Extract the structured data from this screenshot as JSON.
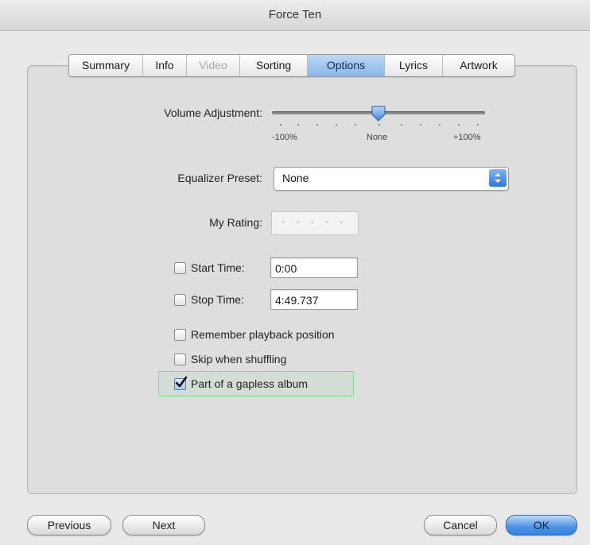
{
  "window": {
    "title": "Force Ten"
  },
  "tabs": [
    {
      "label": "Summary",
      "state": "normal"
    },
    {
      "label": "Info",
      "state": "normal"
    },
    {
      "label": "Video",
      "state": "disabled"
    },
    {
      "label": "Sorting",
      "state": "normal"
    },
    {
      "label": "Options",
      "state": "selected"
    },
    {
      "label": "Lyrics",
      "state": "normal"
    },
    {
      "label": "Artwork",
      "state": "normal"
    }
  ],
  "options": {
    "volume": {
      "label": "Volume Adjustment:",
      "min_label": "-100%",
      "mid_label": "None",
      "max_label": "+100%",
      "value_percent": 0
    },
    "equalizer": {
      "label": "Equalizer Preset:",
      "value": "None"
    },
    "rating": {
      "label": "My Rating:",
      "stars": 0,
      "placeholder": "• • • • •"
    },
    "start_time": {
      "label": "Start Time:",
      "value": "0:00",
      "checked": false
    },
    "stop_time": {
      "label": "Stop Time:",
      "value": "4:49.737",
      "checked": false
    },
    "remember_playback": {
      "label": "Remember playback position",
      "checked": false
    },
    "skip_shuffling": {
      "label": "Skip when shuffling",
      "checked": false
    },
    "gapless": {
      "label": "Part of a gapless album",
      "checked": true
    }
  },
  "buttons": {
    "previous": "Previous",
    "next": "Next",
    "cancel": "Cancel",
    "ok": "OK"
  },
  "colors": {
    "selected_tab": "#8bb6ea",
    "highlight_border": "#7fd88c",
    "ok_button": "#4a91e6"
  }
}
